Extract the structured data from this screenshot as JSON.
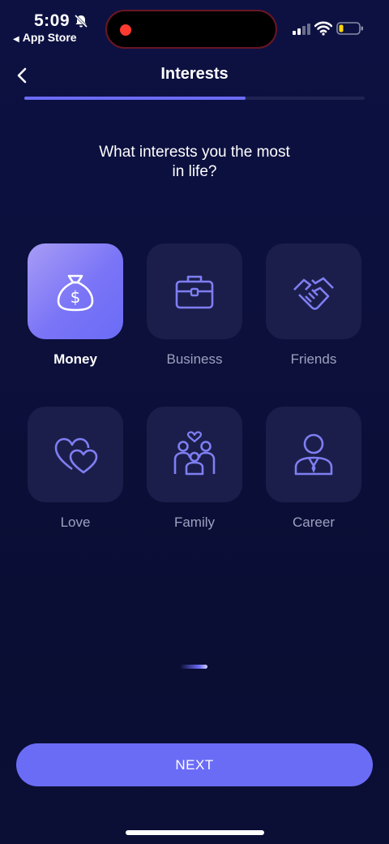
{
  "status_bar": {
    "time": "5:09",
    "back_app_label": "App Store",
    "icons": [
      "bell-slash-icon",
      "recording-dot-icon",
      "signal-icon",
      "wifi-icon",
      "battery-low-icon"
    ]
  },
  "header": {
    "title": "Interests",
    "back_icon": "chevron-left-icon",
    "progress": 0.65
  },
  "question": {
    "line1": "What interests you the most",
    "line2": "in life?"
  },
  "options": [
    {
      "label": "Money",
      "icon": "money-bag-icon",
      "selected": true
    },
    {
      "label": "Business",
      "icon": "briefcase-icon",
      "selected": false
    },
    {
      "label": "Friends",
      "icon": "handshake-icon",
      "selected": false
    },
    {
      "label": "Love",
      "icon": "hearts-icon",
      "selected": false
    },
    {
      "label": "Family",
      "icon": "family-icon",
      "selected": false
    },
    {
      "label": "Career",
      "icon": "person-suit-icon",
      "selected": false
    }
  ],
  "next_button": {
    "label": "NEXT"
  },
  "colors": {
    "accent": "#6b6cf6",
    "background": "#0b0f36",
    "card": "#1b1e4a",
    "label_muted": "#9ea1bf"
  }
}
